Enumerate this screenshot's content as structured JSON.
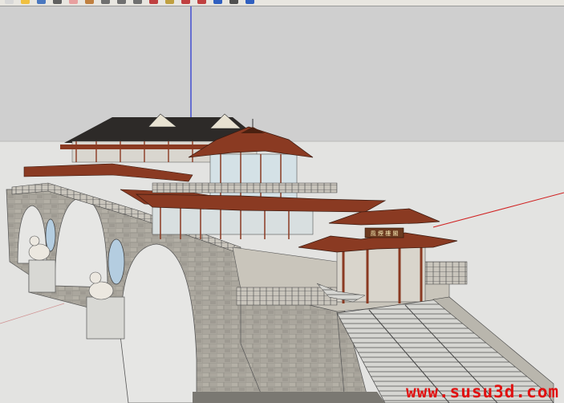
{
  "app": {
    "toolbar": {
      "tools": [
        {
          "name": "new-icon",
          "color": "#d8d8d8"
        },
        {
          "name": "open-icon",
          "color": "#f0c040"
        },
        {
          "name": "save-icon",
          "color": "#4a78c0"
        },
        {
          "name": "select-icon",
          "color": "#606060"
        },
        {
          "name": "eraser-icon",
          "color": "#e8a0a0"
        },
        {
          "name": "pencil-icon",
          "color": "#c08040"
        },
        {
          "name": "rectangle-icon",
          "color": "#707070"
        },
        {
          "name": "circle-icon",
          "color": "#707070"
        },
        {
          "name": "arc-icon",
          "color": "#707070"
        },
        {
          "name": "move-icon",
          "color": "#c04040"
        },
        {
          "name": "push-pull-icon",
          "color": "#c0a040"
        },
        {
          "name": "rotate-icon",
          "color": "#c04040"
        },
        {
          "name": "follow-me-icon",
          "color": "#c04040"
        },
        {
          "name": "orbit-icon",
          "color": "#3060c0"
        },
        {
          "name": "zoom-icon",
          "color": "#505050"
        },
        {
          "name": "zoom-extents-icon",
          "color": "#3060c0"
        }
      ]
    }
  },
  "scene": {
    "sky_color": "#cfcfcf",
    "ground_color": "#e3e3e1",
    "axis_colors": {
      "blue": "#2030d0",
      "red": "#d02020"
    },
    "stone_color": "#a8a49c",
    "roof_color": "#8a3a22",
    "plaque_text": "風 煙 樓 閣"
  },
  "watermark": "www.susu3d.com"
}
